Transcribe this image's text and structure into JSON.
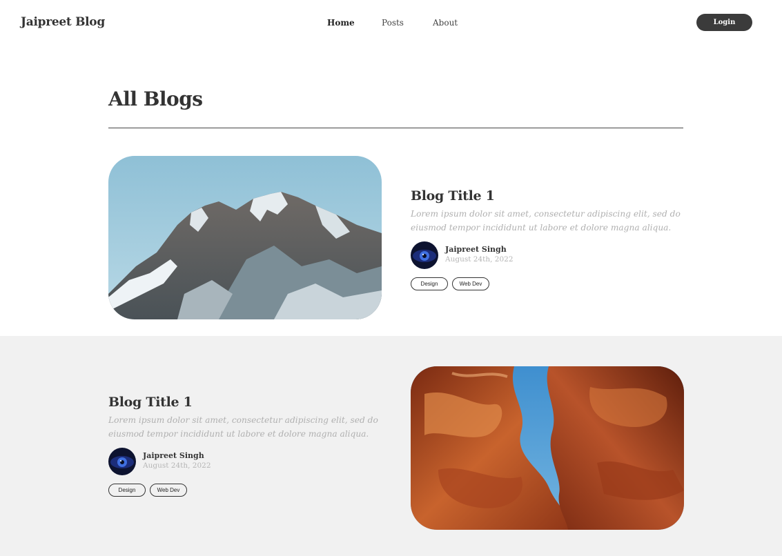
{
  "header": {
    "brand": "Jaipreet Blog",
    "nav": [
      {
        "label": "Home",
        "active": true
      },
      {
        "label": "Posts",
        "active": false
      },
      {
        "label": "About",
        "active": false
      }
    ],
    "login_label": "Login"
  },
  "page": {
    "title": "All Blogs"
  },
  "posts": [
    {
      "title": "Blog Title 1",
      "excerpt": "Lorem ipsum dolor sit amet, consectetur adipiscing elit, sed do eiusmod tempor incididunt ut labore et dolore magna aliqua.",
      "author": "Jaipreet Singh",
      "date": "August 24th, 2022",
      "tags": [
        "Design",
        "Web Dev"
      ],
      "image": "snowy-mountain-photo"
    },
    {
      "title": "Blog Title 1",
      "excerpt": "Lorem ipsum dolor sit amet, consectetur adipiscing elit, sed do eiusmod tempor incididunt ut labore et dolore magna aliqua.",
      "author": "Jaipreet Singh",
      "date": "August 24th, 2022",
      "tags": [
        "Design",
        "Web Dev"
      ],
      "image": "red-canyon-photo"
    }
  ],
  "colors": {
    "primary_dark": "#3b3b3b",
    "muted_text": "#b0b0b0",
    "band_background": "#f1f1f1"
  }
}
